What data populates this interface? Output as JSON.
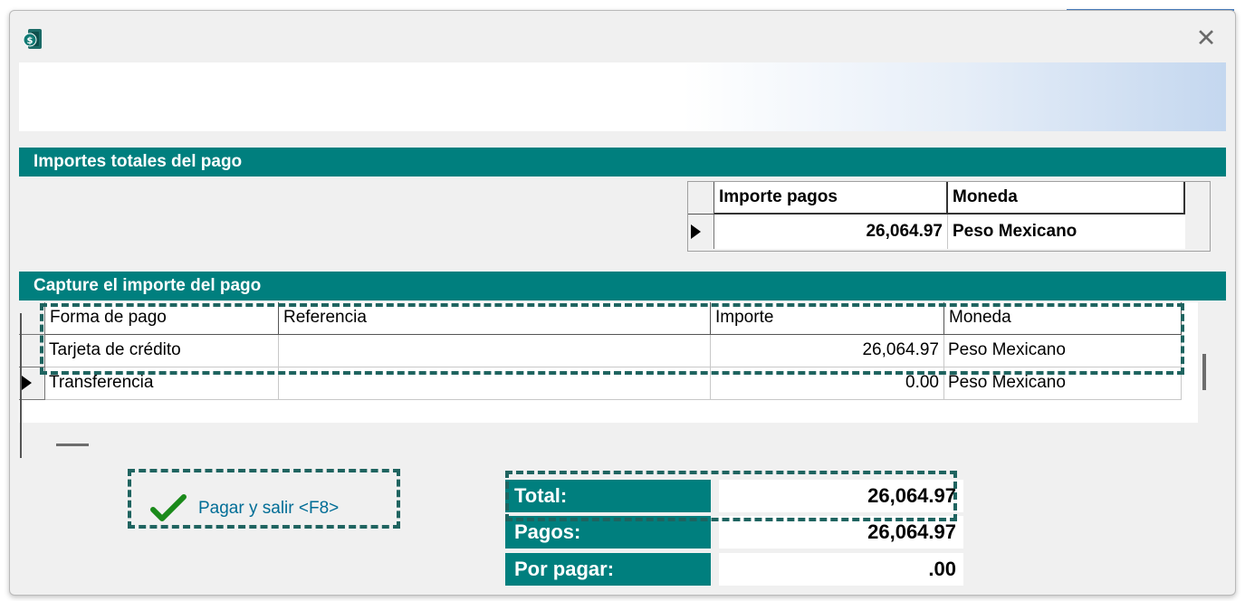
{
  "window": {
    "close_glyph": "✕"
  },
  "section1": {
    "title": "Importes totales del pago",
    "grid": {
      "headers": [
        "Importe pagos",
        "Moneda"
      ],
      "rows": [
        {
          "importe": "26,064.97",
          "moneda": "Peso Mexicano",
          "current": true
        }
      ]
    }
  },
  "section2": {
    "title": "Capture el importe del pago",
    "grid": {
      "headers": [
        "Forma de pago",
        "Referencia",
        "Importe",
        "Moneda"
      ],
      "rows": [
        {
          "forma": "Tarjeta de crédito",
          "referencia": "",
          "importe": "26,064.97",
          "moneda": "Peso Mexicano",
          "current": false
        },
        {
          "forma": "Transferencia",
          "referencia": "",
          "importe": "0.00",
          "moneda": "Peso Mexicano",
          "current": true
        }
      ]
    }
  },
  "pay_button": {
    "label": "Pagar y salir <F8>",
    "icon": "checkmark-icon"
  },
  "totals": {
    "total_label": "Total:",
    "total_value": "26,064.97",
    "pagos_label": "Pagos:",
    "pagos_value": "26,064.97",
    "por_pagar_label": "Por pagar:",
    "por_pagar_value": ".00"
  },
  "colors": {
    "teal": "#007f7e",
    "highlight_dash": "#1f6460",
    "link_blue": "#006d96"
  }
}
